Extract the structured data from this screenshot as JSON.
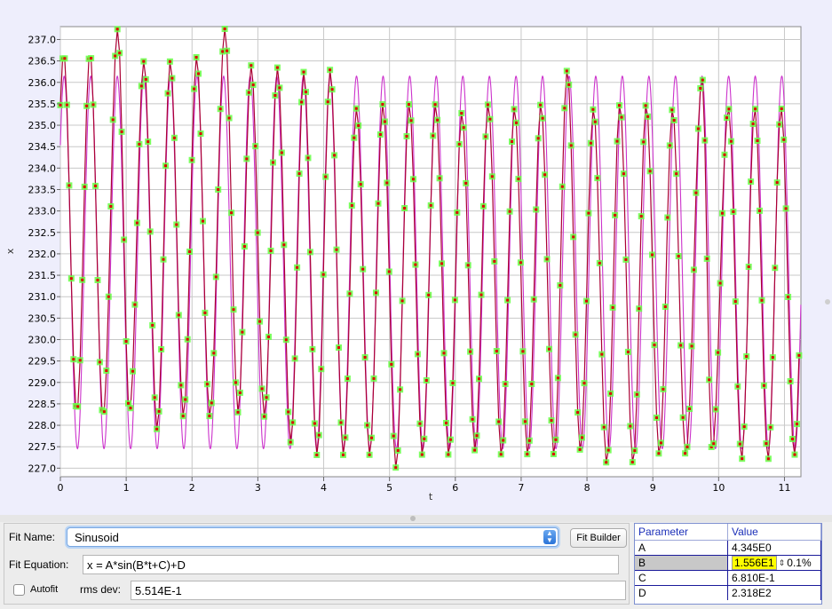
{
  "chart_data": {
    "type": "scatter",
    "title": "",
    "xlabel": "t",
    "ylabel": "x",
    "xlim": [
      0,
      11.25
    ],
    "ylim": [
      226.8,
      237.3
    ],
    "xticks": [
      "0",
      "1",
      "2",
      "3",
      "4",
      "5",
      "6",
      "7",
      "8",
      "9",
      "10",
      "11"
    ],
    "yticks": [
      "227.0",
      "227.5",
      "228.0",
      "228.5",
      "229.0",
      "229.5",
      "230.0",
      "230.5",
      "231.0",
      "231.5",
      "232.0",
      "232.5",
      "233.0",
      "233.5",
      "234.0",
      "234.5",
      "235.0",
      "235.5",
      "236.0",
      "236.5",
      "237.0"
    ],
    "grid": true,
    "colors": {
      "data_line": "#aa0033",
      "marker_fill": "#66ff44",
      "marker_center": "#dd0000",
      "fit_curve": "#cc33cc",
      "background": "#ffffff"
    },
    "series": [
      {
        "kind": "data",
        "sample_step": 0.0333,
        "peaks": [
          {
            "t": 0.05,
            "x": 236.7
          },
          {
            "t": 0.45,
            "x": 236.7
          },
          {
            "t": 0.87,
            "x": 237.25
          },
          {
            "t": 1.27,
            "x": 236.5
          },
          {
            "t": 1.67,
            "x": 236.5
          },
          {
            "t": 2.07,
            "x": 236.6
          },
          {
            "t": 2.5,
            "x": 237.25
          },
          {
            "t": 2.9,
            "x": 236.4
          },
          {
            "t": 3.3,
            "x": 236.35
          },
          {
            "t": 3.7,
            "x": 236.25
          },
          {
            "t": 4.1,
            "x": 236.3
          },
          {
            "t": 4.5,
            "x": 235.4
          },
          {
            "t": 4.9,
            "x": 235.5
          },
          {
            "t": 5.3,
            "x": 235.5
          },
          {
            "t": 5.7,
            "x": 235.5
          },
          {
            "t": 6.1,
            "x": 235.3
          },
          {
            "t": 6.5,
            "x": 235.5
          },
          {
            "t": 6.9,
            "x": 235.4
          },
          {
            "t": 7.3,
            "x": 235.5
          },
          {
            "t": 7.7,
            "x": 236.3
          },
          {
            "t": 8.1,
            "x": 235.4
          },
          {
            "t": 8.5,
            "x": 235.5
          },
          {
            "t": 8.9,
            "x": 235.5
          },
          {
            "t": 9.3,
            "x": 235.4
          },
          {
            "t": 9.75,
            "x": 236.1
          },
          {
            "t": 10.15,
            "x": 235.4
          },
          {
            "t": 10.55,
            "x": 235.4
          },
          {
            "t": 10.95,
            "x": 235.4
          }
        ],
        "troughs": [
          {
            "t": 0.25,
            "x": 228.3
          },
          {
            "t": 0.65,
            "x": 228.2
          },
          {
            "t": 1.05,
            "x": 228.3
          },
          {
            "t": 1.47,
            "x": 227.9
          },
          {
            "t": 1.87,
            "x": 228.2
          },
          {
            "t": 2.27,
            "x": 228.2
          },
          {
            "t": 2.7,
            "x": 228.3
          },
          {
            "t": 3.1,
            "x": 228.2
          },
          {
            "t": 3.5,
            "x": 227.6
          },
          {
            "t": 3.9,
            "x": 227.3
          },
          {
            "t": 4.3,
            "x": 227.3
          },
          {
            "t": 4.7,
            "x": 227.3
          },
          {
            "t": 5.1,
            "x": 227.0
          },
          {
            "t": 5.5,
            "x": 227.3
          },
          {
            "t": 5.9,
            "x": 227.3
          },
          {
            "t": 6.3,
            "x": 227.4
          },
          {
            "t": 6.7,
            "x": 227.3
          },
          {
            "t": 7.1,
            "x": 227.3
          },
          {
            "t": 7.5,
            "x": 227.3
          },
          {
            "t": 7.9,
            "x": 227.4
          },
          {
            "t": 8.3,
            "x": 227.1
          },
          {
            "t": 8.7,
            "x": 227.1
          },
          {
            "t": 9.1,
            "x": 227.3
          },
          {
            "t": 9.5,
            "x": 227.3
          },
          {
            "t": 9.9,
            "x": 227.4
          },
          {
            "t": 10.35,
            "x": 227.2
          },
          {
            "t": 10.75,
            "x": 227.2
          },
          {
            "t": 11.15,
            "x": 227.3
          }
        ]
      },
      {
        "kind": "fit",
        "equation": "x = A*sin(B*t+C)+D",
        "A": 4.345,
        "B": 15.56,
        "C": 0.681,
        "D": 231.8,
        "t_range": [
          0,
          11.25
        ]
      }
    ]
  },
  "fit_panel": {
    "fit_name_label": "Fit Name:",
    "fit_name_value": "Sinusoid",
    "fit_builder_label": "Fit Builder",
    "fit_equation_label": "Fit Equation:",
    "fit_equation_value": "x = A*sin(B*t+C)+D",
    "autofit_label": "Autofit",
    "autofit_checked": false,
    "rms_label": "rms dev:",
    "rms_value": "5.514E-1"
  },
  "params": {
    "header_name": "Parameter",
    "header_value": "Value",
    "rows": [
      {
        "name": "A",
        "value": "4.345E0"
      },
      {
        "name": "B",
        "value": "1.556E1",
        "selected": true,
        "step": "0.1%"
      },
      {
        "name": "C",
        "value": "6.810E-1"
      },
      {
        "name": "D",
        "value": "2.318E2"
      }
    ]
  }
}
